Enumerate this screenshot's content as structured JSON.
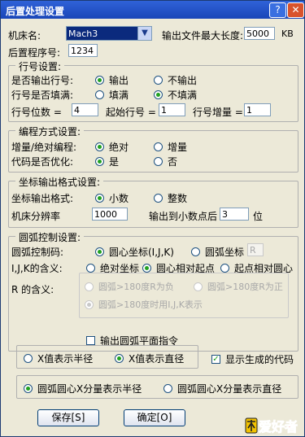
{
  "window": {
    "title": "后置处理设置",
    "help": "?",
    "close": "✕"
  },
  "machine": {
    "label": "机床名:",
    "value": "Mach3"
  },
  "maxlen": {
    "label": "输出文件最大长度:",
    "value": "5000",
    "unit": "KB"
  },
  "program": {
    "label": "后置程序号:",
    "value": "1234"
  },
  "lineno": {
    "group": "行号设置:",
    "output_label": "是否输出行号:",
    "output_yes": "输出",
    "output_no": "不输出",
    "fill_label": "行号是否填满:",
    "fill_yes": "填满",
    "fill_no": "不填满",
    "digits_label": "行号位数 =",
    "digits_value": "4",
    "start_label": "起始行号 =",
    "start_value": "1",
    "inc_label": "行号增量 =",
    "inc_value": "1"
  },
  "mode": {
    "group": "编程方式设置:",
    "abs_label": "增量/绝对编程:",
    "abs_option": "绝对",
    "inc_option": "增量",
    "opt_label": "代码是否优化:",
    "opt_yes": "是",
    "opt_no": "否"
  },
  "coord": {
    "group": "坐标输出格式设置:",
    "fmt_label": "坐标输出格式:",
    "fmt_decimal": "小数",
    "fmt_integer": "整数",
    "res_label": "机床分辨率",
    "res_value": "1000",
    "dec_label": "输出到小数点后",
    "dec_value": "3",
    "dec_unit": "位"
  },
  "arc": {
    "group": "圆弧控制设置:",
    "ctrl_label": "圆弧控制码:",
    "ctrl_center": "圆心坐标(I,J,K)",
    "ctrl_radius": "圆弧坐标",
    "ctrl_radius_value": "R",
    "ijk_label": "I,J,K的含义:",
    "ijk_abs": "绝对坐标",
    "ijk_rel_start": "圆心相对起点",
    "ijk_start_rel": "起点相对圆心",
    "r_label": "R 的含义:",
    "r_neg": "圆弧>180度R为负",
    "r_pos": "圆弧>180度R为正",
    "r_ijk": "圆弧>180度时用I,J,K表示",
    "plane_label": "输出圆弧平面指令"
  },
  "xval": {
    "radius": "X值表示半径",
    "diameter": "X值表示直径",
    "show_code": "显示生成的代码"
  },
  "arcx": {
    "radius": "圆弧圆心X分量表示半径",
    "diameter": "圆弧圆心X分量表示直径"
  },
  "buttons": {
    "save": "保存[S]",
    "ok": "确定[O]"
  },
  "logo": {
    "text": "木工爱好者"
  }
}
